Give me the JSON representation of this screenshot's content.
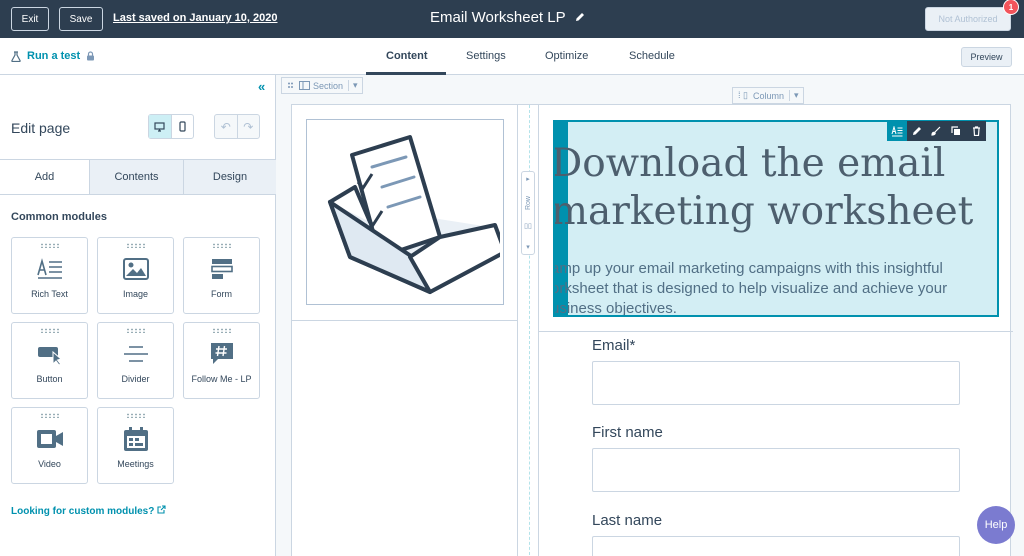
{
  "topbar": {
    "exit_label": "Exit",
    "save_label": "Save",
    "last_saved": "Last saved on January 10, 2020",
    "page_title": "Email Worksheet LP",
    "publish_label": "Not Authorized",
    "notification_count": "1"
  },
  "subbar": {
    "run_test": "Run a test",
    "tabs": [
      "Content",
      "Settings",
      "Optimize",
      "Schedule"
    ],
    "active_tab": "Content",
    "preview_label": "Preview"
  },
  "sidebar": {
    "title": "Edit page",
    "tabs": [
      "Add",
      "Contents",
      "Design"
    ],
    "active_tab": "Add",
    "section_heading": "Common modules",
    "modules": [
      {
        "label": "Rich Text",
        "icon": "rich-text-icon"
      },
      {
        "label": "Image",
        "icon": "image-icon"
      },
      {
        "label": "Form",
        "icon": "form-icon"
      },
      {
        "label": "Button",
        "icon": "button-icon"
      },
      {
        "label": "Divider",
        "icon": "divider-icon"
      },
      {
        "label": "Follow Me - LP",
        "icon": "follow-me-icon"
      },
      {
        "label": "Video",
        "icon": "video-icon"
      },
      {
        "label": "Meetings",
        "icon": "meetings-icon"
      }
    ],
    "custom_link": "Looking for custom modules?"
  },
  "canvas": {
    "section_label": "Section",
    "column_label": "Column",
    "row_label": "Row",
    "hero_heading": "Download the email marketing worksheet",
    "hero_heading_line1": "Download the email",
    "hero_heading_line2": "marketing worksheet",
    "hero_text": "Ramp up your email marketing campaigns with this insightful worksheet that is designed to help visualize and achieve your business objectives.",
    "hero_text_line1": "amp up your email marketing campaigns with this insightful",
    "hero_text_line2": "orksheet that is designed to help visualize and achieve your",
    "hero_text_line3": "usiness objectives.",
    "form_fields": [
      {
        "label": "Email*"
      },
      {
        "label": "First name"
      },
      {
        "label": "Last name"
      }
    ]
  },
  "help_label": "Help",
  "colors": {
    "topbar": "#2d3e50",
    "accent": "#0091ae",
    "hero_bg": "#d3eef4"
  }
}
